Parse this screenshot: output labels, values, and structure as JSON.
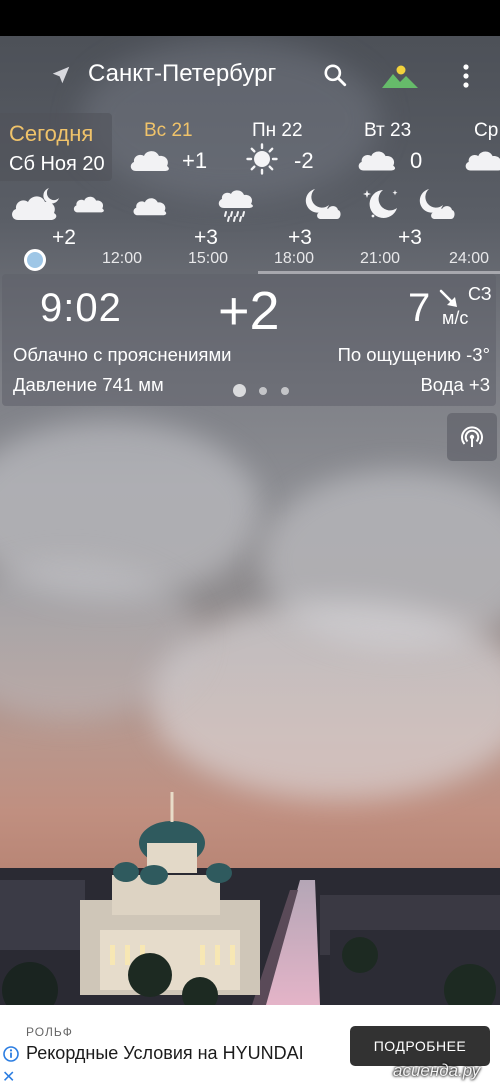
{
  "colors": {
    "accent_weekend": "#f0c36a",
    "now_dot": "#9ec6e6",
    "ad_button": "#323232",
    "ad_close": "#2b7de1"
  },
  "toolbar": {
    "city": "Санкт-Петербург",
    "icons": [
      "navigation-arrow-icon",
      "search-icon",
      "mountain-sun-icon",
      "more-vert-icon"
    ]
  },
  "days": {
    "today_label": "Сегодня",
    "today_date": "Сб Ноя 20",
    "items": [
      {
        "name": "Вс 21",
        "temp": "+1",
        "icon": "cloud-icon",
        "weekend": true
      },
      {
        "name": "Пн 22",
        "temp": "-2",
        "icon": "sun-icon",
        "weekend": false
      },
      {
        "name": "Вт 23",
        "temp": "0",
        "icon": "cloud-icon",
        "weekend": false
      },
      {
        "name": "Ср",
        "temp": "",
        "icon": "cloud-icon",
        "weekend": false
      }
    ]
  },
  "hourly": {
    "temps": [
      "+2",
      "+3",
      "+3",
      "+3"
    ],
    "times": [
      "12:00",
      "15:00",
      "18:00",
      "21:00",
      "24:00"
    ],
    "icons": [
      "cloud-moon-icon",
      "cloud-icon",
      "cloud-icon",
      "rain-cloud-icon",
      "moon-cloud-icon",
      "moon-stars-icon",
      "moon-cloud-icon"
    ]
  },
  "current": {
    "time": "9:02",
    "temp": "+2",
    "wind_speed": "7",
    "wind_dir": "СЗ",
    "wind_unit": "м/с",
    "condition": "Облачно с прояснениями",
    "feels_like": "По ощущению -3°",
    "pressure": "Давление 741 мм",
    "water": "Вода +3",
    "page_index": 0,
    "page_count": 3
  },
  "ad": {
    "brand": "РОЛЬФ",
    "title": "Рекордные Условия на HYUNDAI",
    "button": "ПОДРОБНЕЕ",
    "close": "✕"
  },
  "watermark": "асиенда.ру"
}
